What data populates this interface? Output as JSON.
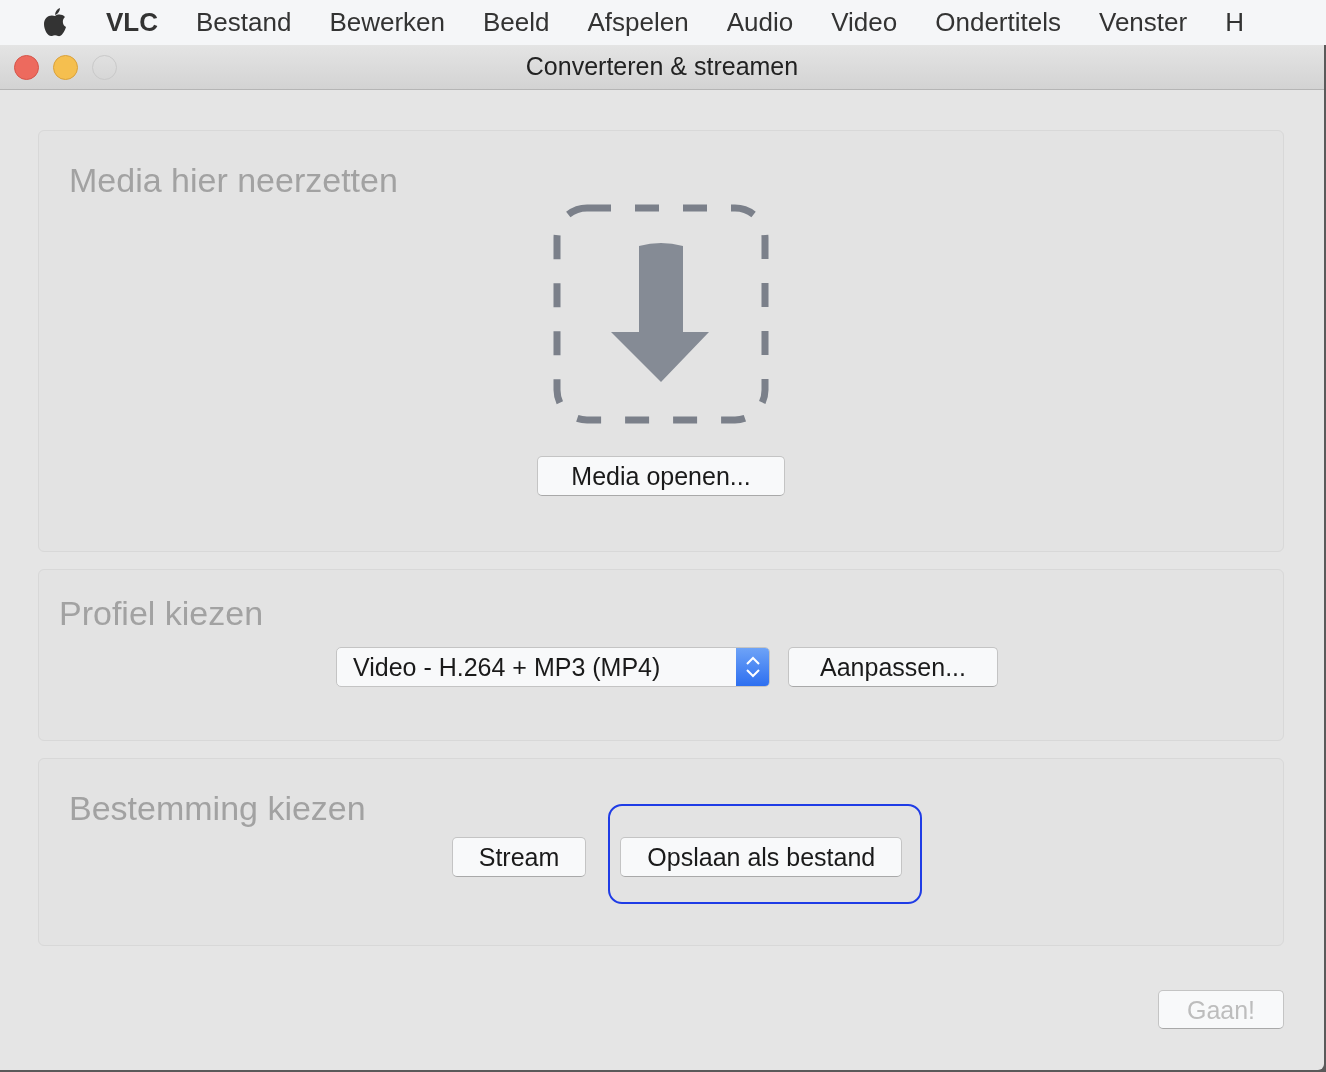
{
  "menu_bar": {
    "app_name": "VLC",
    "items": [
      "Bestand",
      "Bewerken",
      "Beeld",
      "Afspelen",
      "Audio",
      "Video",
      "Ondertitels",
      "Venster",
      "H"
    ]
  },
  "window": {
    "title": "Converteren & streamen"
  },
  "media_section": {
    "heading": "Media hier neerzetten",
    "open_button": "Media openen..."
  },
  "profile_section": {
    "heading": "Profiel kiezen",
    "profile": "Video - H.264 + MP3 (MP4)",
    "customize_button": "Aanpassen..."
  },
  "destination_section": {
    "heading": "Bestemming kiezen",
    "buttons": [
      {
        "label": "Stream",
        "selected": false
      },
      {
        "label": "Opslaan als bestand",
        "selected": true
      }
    ]
  },
  "go_button": {
    "label": "Gaan!",
    "disabled": true
  }
}
